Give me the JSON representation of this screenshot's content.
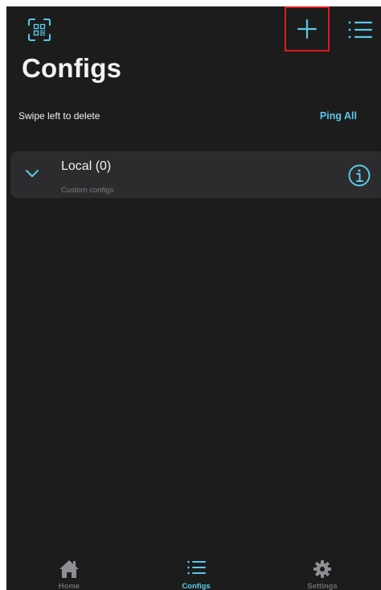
{
  "header": {
    "title": "Configs",
    "qr_icon": "qr-scan-icon",
    "add_icon": "plus-icon",
    "menu_icon": "list-icon"
  },
  "toolbar": {
    "hint": "Swipe left to delete",
    "ping_all": "Ping All"
  },
  "groups": [
    {
      "title": "Local (0)",
      "subtitle": "Custom configs",
      "expand_icon": "chevron-down-icon",
      "info_icon": "info-icon"
    }
  ],
  "tabs": [
    {
      "label": "Home",
      "icon": "home-icon",
      "active": false
    },
    {
      "label": "Configs",
      "icon": "list-icon",
      "active": true
    },
    {
      "label": "Settings",
      "icon": "gear-icon",
      "active": false
    }
  ],
  "colors": {
    "background": "#1c1c1d",
    "card": "#2c2c2e",
    "accent": "#59c9e8",
    "text": "#f2f2f4",
    "muted": "#6d6d72",
    "highlight_box": "#e0191f"
  }
}
